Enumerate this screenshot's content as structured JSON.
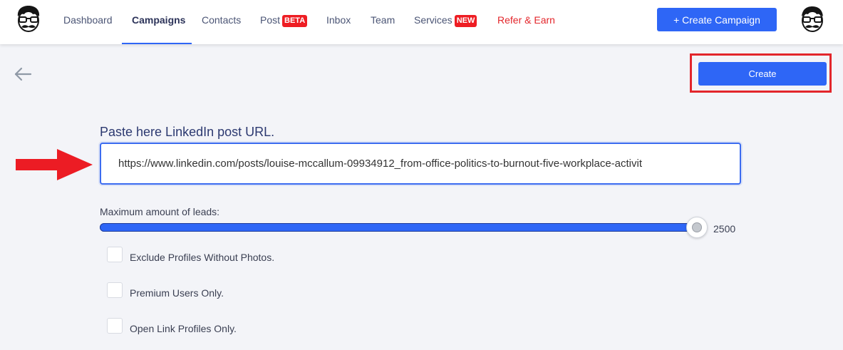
{
  "nav": {
    "items": [
      {
        "label": "Dashboard"
      },
      {
        "label": "Campaigns"
      },
      {
        "label": "Contacts"
      },
      {
        "label": "Post",
        "badge": "BETA"
      },
      {
        "label": "Inbox"
      },
      {
        "label": "Team"
      },
      {
        "label": "Services",
        "badge": "NEW"
      },
      {
        "label": "Refer & Earn"
      }
    ],
    "create_campaign_label": "+ Create Campaign"
  },
  "toolbar": {
    "create_label": "Create"
  },
  "form": {
    "url_label": "Paste here LinkedIn post URL.",
    "url_value": "https://www.linkedin.com/posts/louise-mccallum-09934912_from-office-politics-to-burnout-five-workplace-activit",
    "leads_label": "Maximum amount of leads:",
    "leads_value": "2500",
    "leads_fraction": 1.0,
    "options": [
      {
        "label": "Exclude Profiles Without Photos.",
        "checked": false
      },
      {
        "label": "Premium Users Only.",
        "checked": false
      },
      {
        "label": "Open Link Profiles Only.",
        "checked": false
      }
    ]
  },
  "colors": {
    "accent": "#2e66f6",
    "badge_red": "#ee1d23",
    "highlight_red": "#e3262b"
  },
  "icons": {
    "logo": "mustache-glasses-face-icon",
    "avatar": "mustache-glasses-face-icon",
    "back": "arrow-left-icon",
    "annotation": "red-arrow-right-icon"
  }
}
